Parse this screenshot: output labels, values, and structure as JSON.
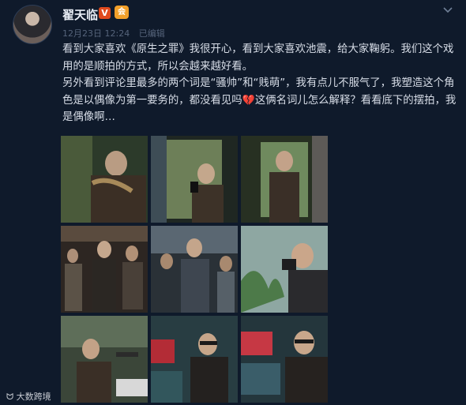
{
  "author": {
    "name": "翟天临",
    "verified_badge": "V",
    "member_badge": "会"
  },
  "meta": {
    "date": "12月23日 12:24",
    "status": "已编辑"
  },
  "post": {
    "para1": "看到大家喜欢《原生之罪》我很开心，看到大家喜欢池震，给大家鞠躬。我们这个戏用的是顺拍的方式，所以会越来越好看。",
    "para2a": "另外看到评论里最多的两个词是“骚帅”和“贱萌”，我有点儿不服气了，我塑造这个角色是以偶像为第一要务的，都没看见吗",
    "para2b": "这俩名词儿怎么解释？看看底下的摆拍，我是偶像啊…"
  },
  "photos": [
    "photo-1",
    "photo-2",
    "photo-3",
    "photo-4",
    "photo-5",
    "photo-6",
    "photo-7",
    "photo-8",
    "photo-9"
  ],
  "watermark": "大数跨境",
  "icons": {
    "more": "chevron-down-icon",
    "heart": "broken-heart-emoji"
  },
  "colors": {
    "background": "#0f1a2b",
    "text": "#d8dee8",
    "meta": "#55637a",
    "verified": "#e04a1e",
    "member": "#f2a02a"
  }
}
